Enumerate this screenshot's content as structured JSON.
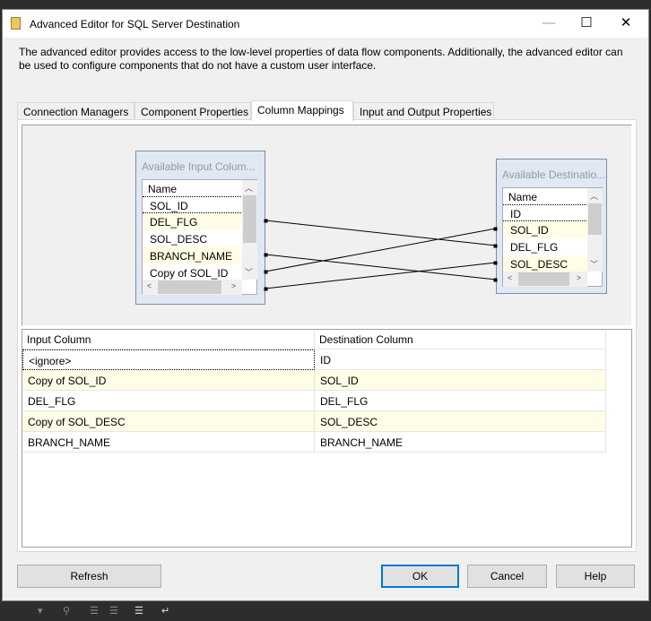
{
  "window": {
    "title": "Advanced Editor for SQL Server Destination",
    "minimize": "—",
    "maximize": "☐",
    "close": "✕"
  },
  "description": "The advanced editor provides access to the low-level properties of data flow components. Additionally, the advanced editor can be used to configure components that do not have a custom user interface.",
  "tabs": [
    {
      "label": "Connection Managers"
    },
    {
      "label": "Component Properties"
    },
    {
      "label": "Column Mappings",
      "active": true
    },
    {
      "label": "Input and Output Properties"
    }
  ],
  "input_box": {
    "caption": "Available Input Colum...",
    "header": "Name",
    "rows": [
      "SOL_ID",
      "DEL_FLG",
      "SOL_DESC",
      "BRANCH_NAME",
      "Copy of SOL_ID"
    ]
  },
  "dest_box": {
    "caption": "Available Destinatio...",
    "header": "Name",
    "rows": [
      "ID",
      "SOL_ID",
      "DEL_FLG",
      "SOL_DESC"
    ]
  },
  "mapping_grid": {
    "headers": [
      "Input Column",
      "Destination Column"
    ],
    "rows": [
      {
        "input": "<ignore>",
        "dest": "ID"
      },
      {
        "input": "Copy of SOL_ID",
        "dest": "SOL_ID"
      },
      {
        "input": "DEL_FLG",
        "dest": "DEL_FLG"
      },
      {
        "input": "Copy of SOL_DESC",
        "dest": "SOL_DESC"
      },
      {
        "input": "BRANCH_NAME",
        "dest": "BRANCH_NAME"
      }
    ]
  },
  "buttons": {
    "refresh": "Refresh",
    "ok": "OK",
    "cancel": "Cancel",
    "help": "Help"
  },
  "colors": {
    "accent": "#0078d7",
    "alt_row": "#fffde6"
  }
}
